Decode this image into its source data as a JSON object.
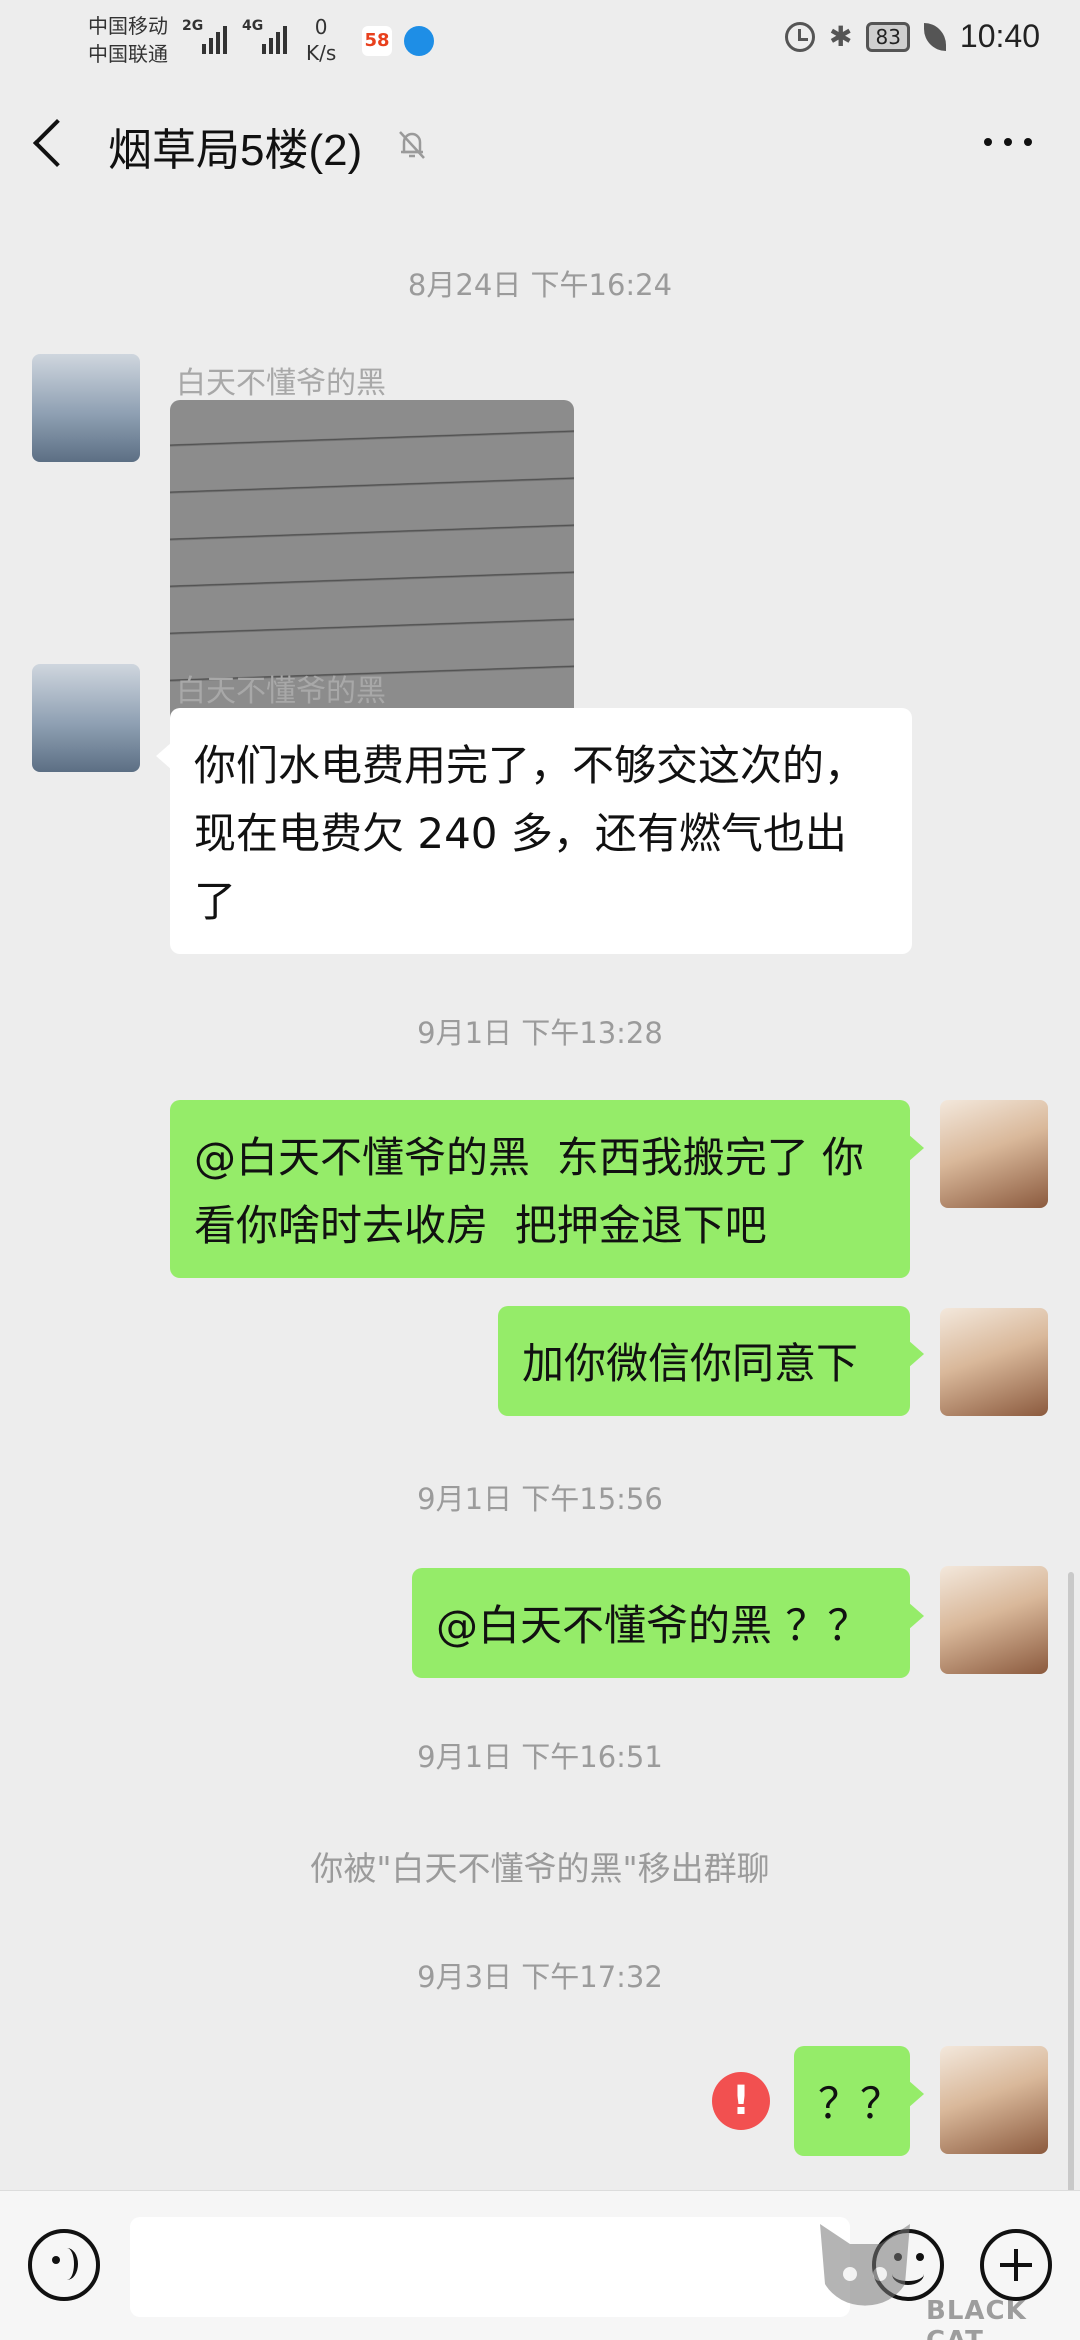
{
  "status_bar": {
    "carrier_1": "中国移动",
    "carrier_2": "中国联通",
    "net_1": "2G",
    "net_2": "4G",
    "speed_value": "0",
    "speed_unit": "K/s",
    "app_badge": "58",
    "bluetooth_glyph": "✱",
    "battery": "83",
    "time": "10:40"
  },
  "nav": {
    "title": "烟草局5楼(2)",
    "back_icon": "chevron-left-icon",
    "mute_icon": "bell-off-icon",
    "more_icon": "more-icon"
  },
  "chat": {
    "messages": [
      {
        "type": "timestamp",
        "text": "8月24日 下午16:24"
      },
      {
        "type": "image",
        "side": "left",
        "sender": "白天不懂爷的黑",
        "alt": "handwritten utility ledger photo"
      },
      {
        "type": "text",
        "side": "left",
        "sender": "白天不懂爷的黑",
        "text": "你们水电费用完了，不够交这次的，现在电费欠 240 多，还有燃气也出了"
      },
      {
        "type": "timestamp",
        "text": "9月1日 下午13:28"
      },
      {
        "type": "text",
        "side": "right",
        "text": "@白天不懂爷的黑  东西我搬完了 你看你啥时去收房  把押金退下吧"
      },
      {
        "type": "text",
        "side": "right",
        "text": "加你微信你同意下"
      },
      {
        "type": "timestamp",
        "text": "9月1日 下午15:56"
      },
      {
        "type": "text",
        "side": "right",
        "text": "@白天不懂爷的黑 ？？"
      },
      {
        "type": "timestamp",
        "text": "9月1日 下午16:51"
      },
      {
        "type": "system",
        "text": "你被\"白天不懂爷的黑\"移出群聊"
      },
      {
        "type": "timestamp",
        "text": "9月3日 下午17:32"
      },
      {
        "type": "text",
        "side": "right",
        "text": "？？",
        "failed": true,
        "failed_glyph": "!"
      }
    ]
  },
  "input_bar": {
    "value": "",
    "voice_icon": "voice-icon",
    "emoji_icon": "emoji-icon",
    "plus_icon": "plus-icon"
  },
  "watermark": {
    "text": "BLACK CAT"
  },
  "colors": {
    "background": "#ededed",
    "bubble_me": "#95ec69",
    "bubble_other": "#ffffff",
    "error": "#f25050"
  }
}
